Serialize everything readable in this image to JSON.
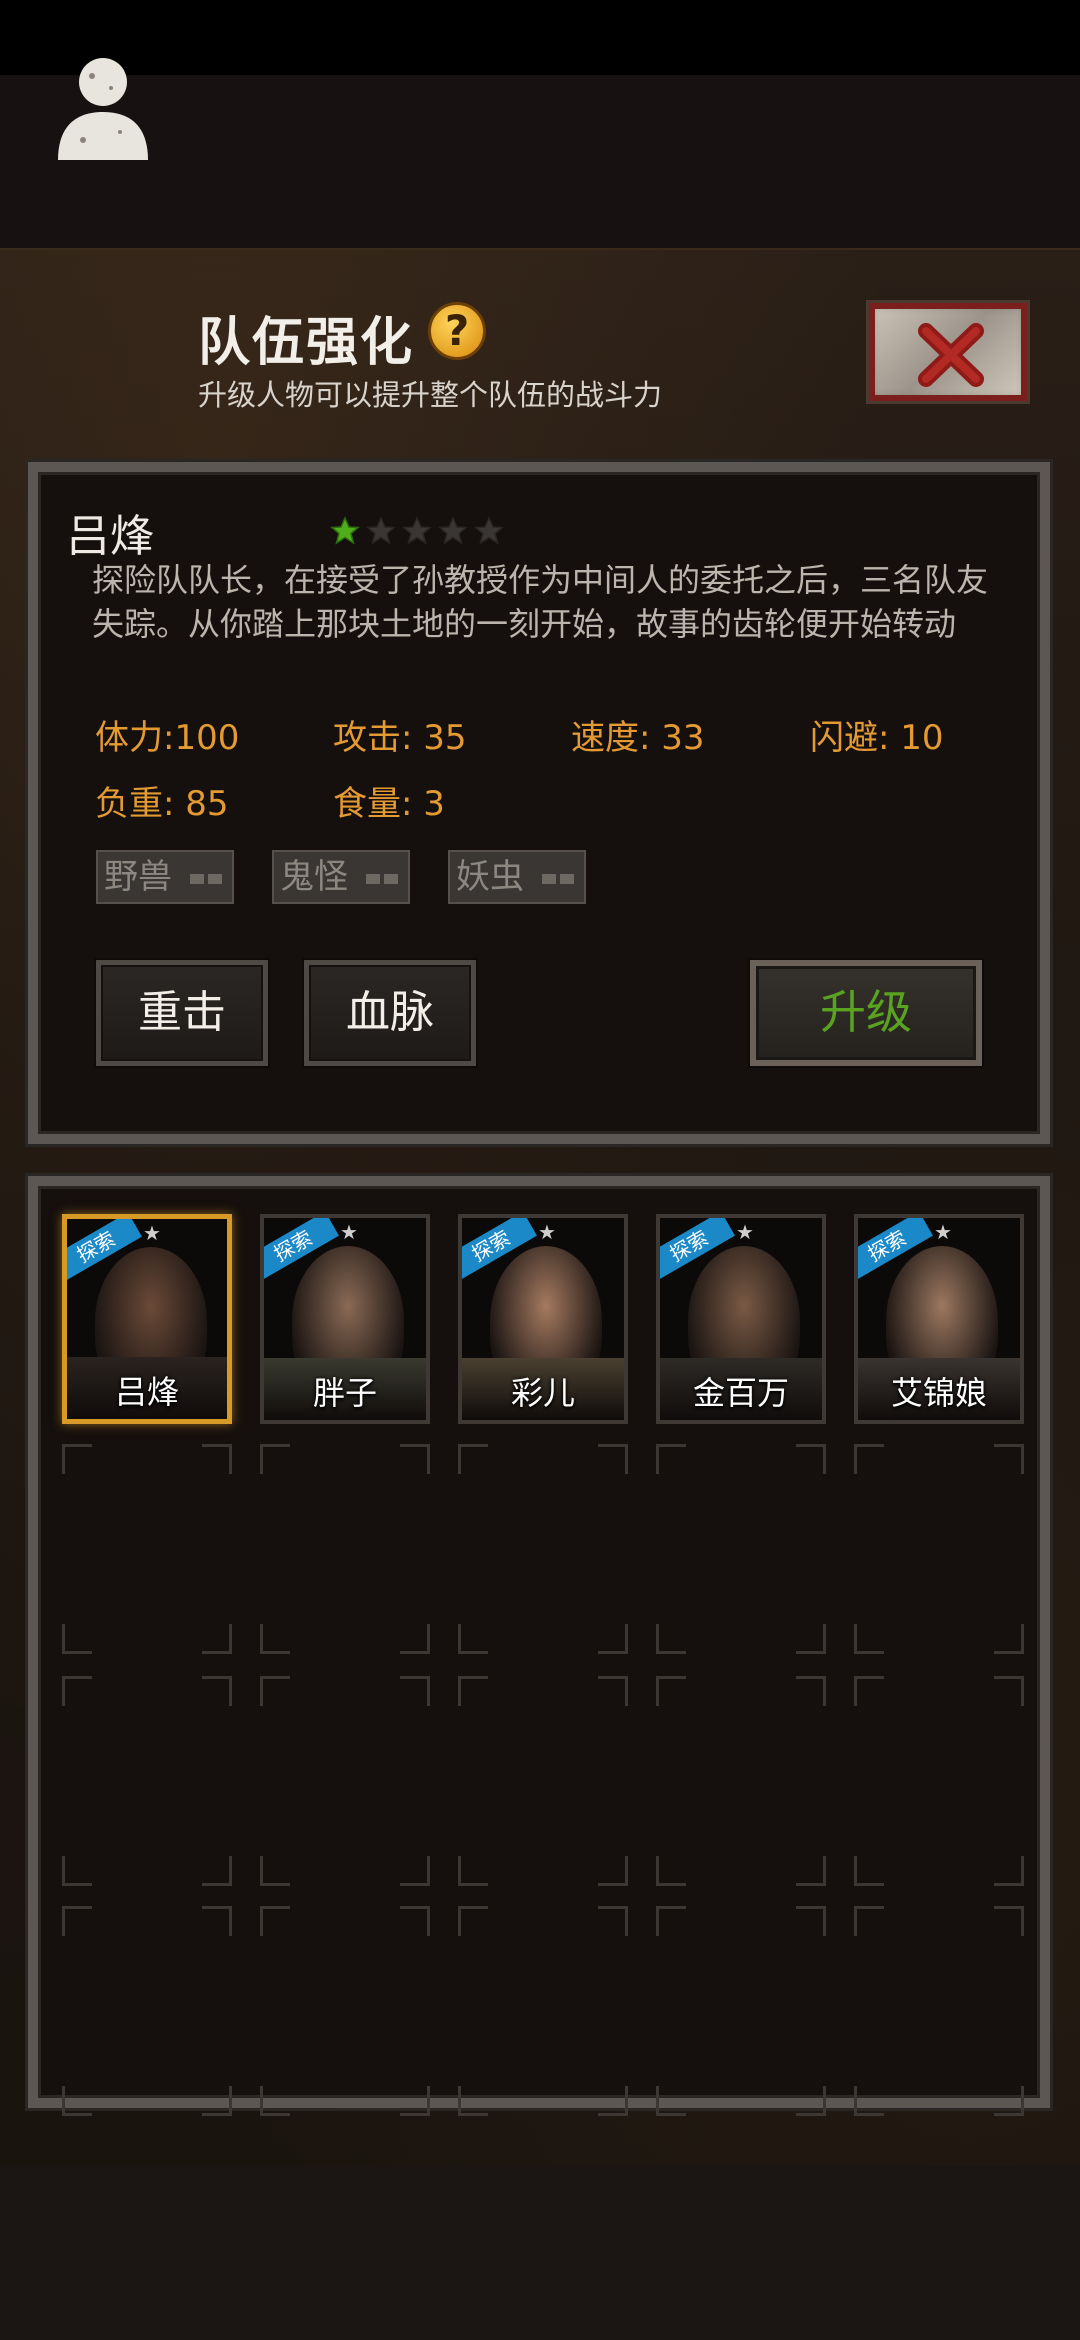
{
  "header": {
    "title": "队伍强化",
    "help_icon": "?",
    "subtitle": "升级人物可以提升整个队伍的战斗力"
  },
  "character": {
    "name": "吕烽",
    "stars_filled": 1,
    "stars_total": 5,
    "description": "探险队队长，在接受了孙教授作为中间人的委托之后，三名队友失踪。从你踏上那块土地的一刻开始，故事的齿轮便开始转动",
    "stats": [
      {
        "label": "体力:",
        "value": "100"
      },
      {
        "label": "攻击:",
        "value": "35"
      },
      {
        "label": "速度:",
        "value": "33"
      },
      {
        "label": "闪避:",
        "value": "10"
      },
      {
        "label": "负重:",
        "value": "85"
      },
      {
        "label": "食量:",
        "value": "3"
      }
    ],
    "traits": [
      "野兽",
      "鬼怪",
      "妖虫"
    ],
    "skills": [
      "重击",
      "血脉"
    ],
    "upgrade_label": "升级"
  },
  "roster": {
    "tag_label": "探索",
    "members": [
      {
        "name": "吕烽",
        "selected": true
      },
      {
        "name": "胖子",
        "selected": false
      },
      {
        "name": "彩儿",
        "selected": false
      },
      {
        "name": "金百万",
        "selected": false
      },
      {
        "name": "艾锦娘",
        "selected": false
      }
    ]
  },
  "colors": {
    "stat_orange": "#e39a33",
    "upgrade_green": "#5aa321",
    "selected_border": "#d79a27",
    "tag_blue": "#1b89c8",
    "star_green": "#4fae1a"
  }
}
